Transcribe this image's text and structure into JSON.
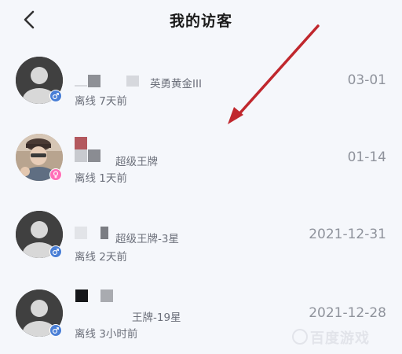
{
  "header": {
    "title": "我的访客",
    "back_icon": "chevron-left-icon"
  },
  "visitors": [
    {
      "level_label": "英勇黄金III",
      "status": "离线 7天前",
      "date": "03-01",
      "gender": "male",
      "avatar": "default-avatar"
    },
    {
      "level_label": "超级王牌",
      "status": "离线 1天前",
      "date": "01-14",
      "gender": "female",
      "avatar": "photo-avatar"
    },
    {
      "level_label": "超级王牌-3星",
      "status": "离线 2天前",
      "date": "2021-12-31",
      "gender": "male",
      "avatar": "default-avatar"
    },
    {
      "level_label": "王牌-19星",
      "status": "离线 3小时前",
      "date": "2021-12-28",
      "gender": "male",
      "avatar": "default-avatar"
    }
  ],
  "annotation": {
    "arrow_color": "#c0272d"
  },
  "watermark": {
    "text": "百度游戏"
  },
  "colors": {
    "background": "#f5f7fb",
    "male": "#4a7fd6",
    "female": "#ff6fb8"
  }
}
